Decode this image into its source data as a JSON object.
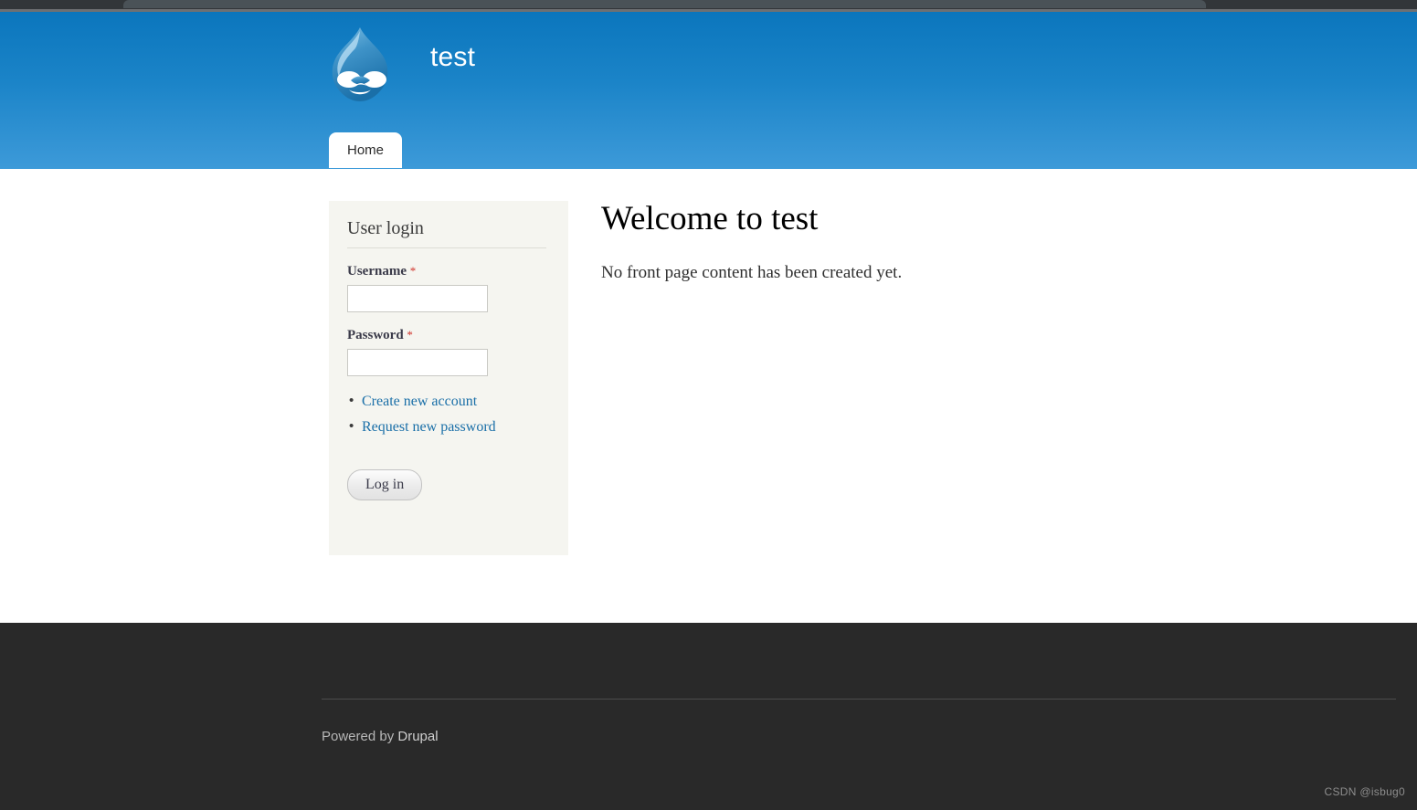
{
  "browser": {
    "chrome_color": "#323639",
    "tab_color": "#4a5257"
  },
  "header": {
    "site_name": "test",
    "logo_icon": "drupal-droplet-logo",
    "gradient_top": "#0b76bd",
    "gradient_bottom": "#3d9ad9"
  },
  "nav": {
    "tabs": [
      {
        "label": "Home",
        "active": true
      }
    ]
  },
  "sidebar": {
    "block_title": "User login",
    "background": "#f5f5f0",
    "fields": [
      {
        "label": "Username",
        "required_marker": "*",
        "value": "",
        "placeholder": ""
      },
      {
        "label": "Password",
        "required_marker": "*",
        "value": "",
        "placeholder": ""
      }
    ],
    "links": [
      {
        "label": "Create new account"
      },
      {
        "label": "Request new password"
      }
    ],
    "submit_label": "Log in",
    "link_color": "#1a6fa8",
    "required_color": "#d0342c"
  },
  "main": {
    "title": "Welcome to test",
    "body": "No front page content has been created yet."
  },
  "footer": {
    "powered_prefix": "Powered by ",
    "powered_link": "Drupal",
    "background": "#292929"
  },
  "watermark": {
    "text": "CSDN @isbug0"
  }
}
